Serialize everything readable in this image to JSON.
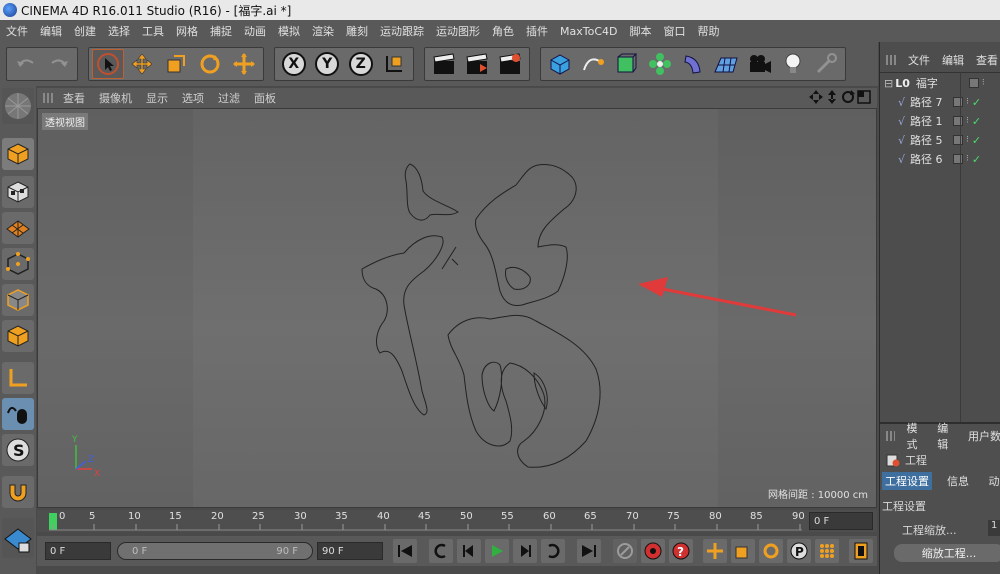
{
  "window": {
    "title": "CINEMA 4D R16.011 Studio (R16) - [福字.ai *]"
  },
  "menu": [
    "文件",
    "编辑",
    "创建",
    "选择",
    "工具",
    "网格",
    "捕捉",
    "动画",
    "模拟",
    "渲染",
    "雕刻",
    "运动跟踪",
    "运动图形",
    "角色",
    "插件",
    "MaxToC4D",
    "脚本",
    "窗口",
    "帮助"
  ],
  "toolbar": {
    "axis_x": "X",
    "axis_y": "Y",
    "axis_z": "Z"
  },
  "viewport": {
    "menu": [
      "查看",
      "摄像机",
      "显示",
      "选项",
      "过滤",
      "面板"
    ],
    "view_name": "透视视图",
    "grid_spacing": "网格间距 : 10000 cm",
    "axis_labels": {
      "y": "Y",
      "z": "Z",
      "x": "X"
    }
  },
  "timeline": {
    "ticks": [
      "0",
      "5",
      "10",
      "15",
      "20",
      "25",
      "30",
      "35",
      "40",
      "45",
      "50",
      "55",
      "60",
      "65",
      "70",
      "75",
      "80",
      "85",
      "90"
    ],
    "current_frame": "0 F",
    "start_frame": "0 F",
    "range_start": "0 F",
    "range_end": "90 F",
    "end_frame": "90 F"
  },
  "object_manager": {
    "menu": [
      "文件",
      "编辑",
      "查看"
    ],
    "objects": [
      {
        "name": "福字",
        "icon": "null-object-icon"
      },
      {
        "name": "路径 7",
        "icon": "spline-icon"
      },
      {
        "name": "路径 1",
        "icon": "spline-icon"
      },
      {
        "name": "路径 5",
        "icon": "spline-icon"
      },
      {
        "name": "路径 6",
        "icon": "spline-icon"
      }
    ]
  },
  "attribute_manager": {
    "menu": [
      "模式",
      "编辑",
      "用户数"
    ],
    "header": "工程",
    "tabs": [
      "工程设置",
      "信息",
      "动"
    ],
    "section": "工程设置",
    "field_label": "工程缩放...",
    "field_value": "1",
    "scale_button": "缩放工程..."
  }
}
